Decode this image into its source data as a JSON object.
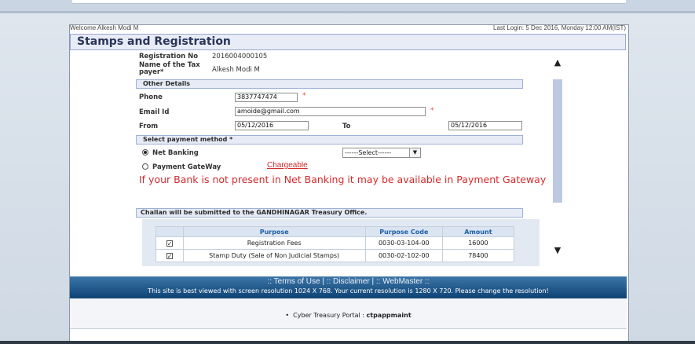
{
  "header": {
    "welcome": "Welcome Alkesh Modi M",
    "last_login": "Last Login: 5 Dec 2016, Monday 12:00 AM(IST)",
    "page_title": "Stamps and Registration"
  },
  "registration": {
    "reg_no_label": "Registration No",
    "reg_no_value": "2016004000105",
    "taxpayer_label": "Name of the Tax payer*",
    "taxpayer_value": "Alkesh Modi M"
  },
  "other_details": {
    "section_label": "Other Details",
    "phone_label": "Phone",
    "phone_value": "3837747474",
    "email_label": "Email Id",
    "email_value": "amoide@gmail.com",
    "from_label": "From",
    "from_value": "05/12/2016",
    "to_label": "To",
    "to_value": "05/12/2016",
    "required_mark": "*"
  },
  "payment": {
    "section_label": "Select payment method",
    "required_mark": "*",
    "net_banking_label": "Net Banking",
    "net_banking_selected": true,
    "bank_select_value": "------Select------",
    "gateway_label": "Payment GateWay",
    "chargeable_label": "Chargeable",
    "notice": "If your Bank is not present in Net Banking it may be available in Payment Gateway"
  },
  "challan": {
    "label": "Challan will be submitted to the GANDHINAGAR Treasury Office.",
    "columns": [
      "Purpose",
      "Purpose Code",
      "Amount"
    ],
    "rows": [
      {
        "checked": true,
        "purpose": "Registration Fees",
        "code": "0030-03-104-00",
        "amount": "16000"
      },
      {
        "checked": true,
        "purpose": "Stamp Duty (Sale of Non Judicial Stamps)",
        "code": "0030-02-102-00",
        "amount": "78400"
      }
    ]
  },
  "footer": {
    "links": ":: Terms of Use | :: Disclaimer | :: WebMaster ::",
    "resolution_note": "This site is best viewed with screen resolution 1024 X 768. Your current resolution is 1280 X 720. Please change the resolution!",
    "portal_prefix": "Cyber Treasury Portal : ",
    "portal_name": "ctpappmaint"
  },
  "icons": {
    "scroll_up": "▲",
    "scroll_down": "▼",
    "select_arrow": "▼",
    "checkmark": "✓",
    "bullet": "•"
  },
  "colors": {
    "title_text": "#2a3559",
    "notice_red": "#d52b2b",
    "footer_blue": "#0e4274",
    "section_bg": "#e6ebf6"
  }
}
